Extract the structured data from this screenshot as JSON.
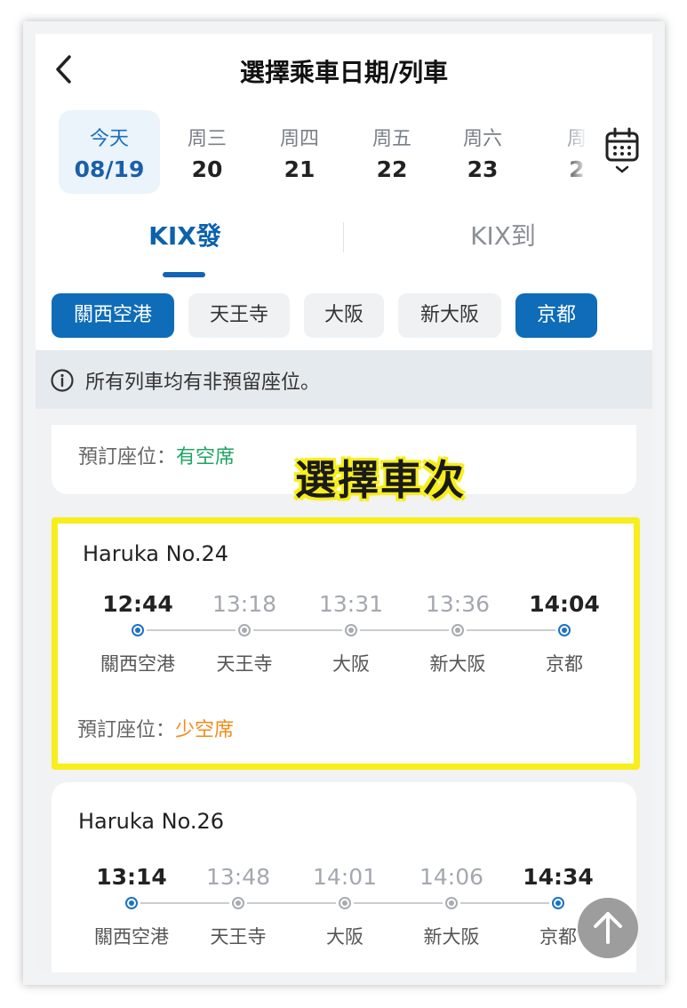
{
  "header": {
    "title": "選擇乘車日期/列車"
  },
  "dates": [
    {
      "dow": "今天",
      "num": "08/19",
      "active": true
    },
    {
      "dow": "周三",
      "num": "20"
    },
    {
      "dow": "周四",
      "num": "21"
    },
    {
      "dow": "周五",
      "num": "22"
    },
    {
      "dow": "周六",
      "num": "23"
    },
    {
      "dow": "周",
      "num": "2"
    }
  ],
  "direction_tabs": {
    "depart": "KIX發",
    "arrive": "KIX到"
  },
  "station_chips": [
    "關西空港",
    "天王寺",
    "大阪",
    "新大阪",
    "京都"
  ],
  "notice": {
    "text": "所有列車均有非預留座位。"
  },
  "overlay": {
    "label": "選擇車次"
  },
  "seat_label": "預訂座位：",
  "prev_card": {
    "seat_status": "有空席"
  },
  "trains": [
    {
      "name": "Haruka No.24",
      "times": [
        "12:44",
        "13:18",
        "13:31",
        "13:36",
        "14:04"
      ],
      "stations": [
        "關西空港",
        "天王寺",
        "大阪",
        "新大阪",
        "京都"
      ],
      "seat_status": "少空席"
    },
    {
      "name": "Haruka No.26",
      "times": [
        "13:14",
        "13:48",
        "14:01",
        "14:06",
        "14:34"
      ],
      "stations": [
        "關西空港",
        "天王寺",
        "大阪",
        "新大阪",
        "京都"
      ]
    }
  ],
  "colors": {
    "accent": "#0e6cb8",
    "available": "#1fa463",
    "few": "#f08c1a",
    "highlight": "#f7ee1c"
  }
}
